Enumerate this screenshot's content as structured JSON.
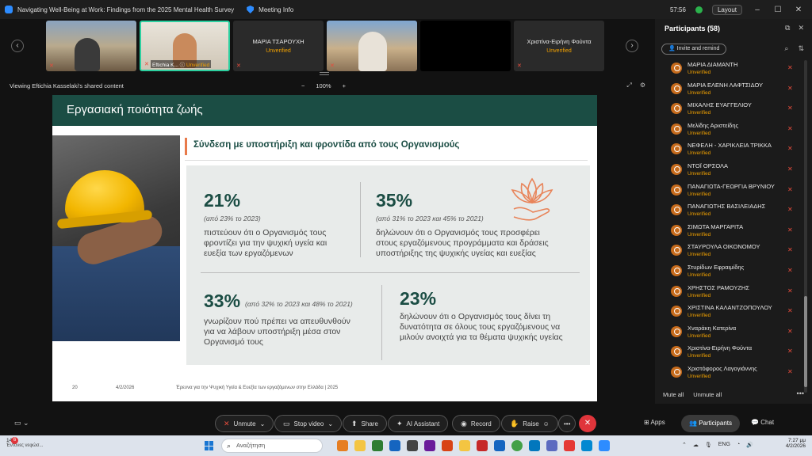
{
  "titlebar": {
    "title": "Navigating Well-Being at Work: Findings from the 2025 Mental Health Survey",
    "meeting_info": "Meeting Info",
    "time": "57:56",
    "layout": "Layout"
  },
  "strip": {
    "tiles": [
      {
        "name": "",
        "status": "",
        "caption_name": "",
        "caption_status": ""
      },
      {
        "name": "",
        "status": "",
        "caption_name": "Eftichia K...",
        "caption_status": "Unverified"
      },
      {
        "name": "ΜΑΡΙΑ ΤΣΑΡΟΥΧΗ",
        "status": "Unverified"
      },
      {
        "name": "",
        "status": ""
      },
      {
        "name": "",
        "status": ""
      },
      {
        "name": "Χριστίνα-Ειρήνη Φούντα",
        "status": "Unverified"
      }
    ]
  },
  "sharebar": {
    "label": "Viewing Eftichia Kasselaki's shared content",
    "zoom": "100%",
    "minus": "−",
    "plus": "+"
  },
  "slide": {
    "header": "Εργασιακή ποιότητα ζωής",
    "subtitle": "Σύνδεση με υποστήριξη και φροντίδα από τους Οργανισμούς",
    "stats": [
      {
        "value": "21%",
        "note": "(από 23% το 2023)",
        "text": [
          "πιστεύουν ότι ο Οργανισμός τους",
          "φροντίζει για την ψυχική υγεία και",
          "ευεξία των εργαζόμενων"
        ]
      },
      {
        "value": "35%",
        "note": "(από 31% το 2023 και 45% το 2021)",
        "text": [
          "δηλώνουν ότι ο Οργανισμός τους προσφέρει",
          "στους εργαζόμενους προγράμματα και δράσεις",
          "υποστήριξης της ψυχικής υγείας και ευεξίας"
        ]
      },
      {
        "value": "33%",
        "note": "(από 32% το 2023 και 48% το 2021)",
        "text": [
          "γνωρίζουν πού πρέπει να απευθυνθούν",
          "για να λάβουν υποστήριξη μέσα στον",
          "Οργανισμό τους"
        ]
      },
      {
        "value": "23%",
        "note": "",
        "text": [
          "δηλώνουν ότι ο Οργανισμός τους δίνει τη",
          "δυνατότητα σε όλους τους εργαζόμενους να",
          "μιλούν ανοιχτά για τα θέματα ψυχικής υγείας"
        ]
      }
    ],
    "footer": {
      "page": "20",
      "date": "4/2/2026",
      "source": "Έρευνα για την Ψυχική Υγεία & Ευεξία των εργαζόμενων στην Ελλάδα | 2025"
    }
  },
  "participants": {
    "title": "Participants (58)",
    "invite": "Invite and remind",
    "list": [
      {
        "name": "ΜΑΡΙΑ ΔΙΑΜΑΝΤΗ",
        "status": "Unverified"
      },
      {
        "name": "ΜΑΡΙΑ ΕΛΕΝΗ ΛΑΦΤΣΙΔΟΥ",
        "status": "Unverified"
      },
      {
        "name": "ΜΙΧΑΛΗΣ ΕΥΑΓΓΕΛΙΟΥ",
        "status": "Unverified"
      },
      {
        "name": "Μελίδης Αριστείδης",
        "status": "Unverified"
      },
      {
        "name": "ΝΕΦΕΛΗ - ΧΑΡΙΚΛΕΙΑ ΤΡΙΚΚΑ",
        "status": "Unverified"
      },
      {
        "name": "ΝΤΟΪ ΟΡΣΟΛΑ",
        "status": "Unverified"
      },
      {
        "name": "ΠΑΝΑΓΙΩΤΑ-ΓΕΩΡΓΙΑ ΒΡΥΝΙΟΥ",
        "status": "Unverified"
      },
      {
        "name": "ΠΑΝΑΓΙΩΤΗΣ ΒΑΣΙΛΕΙΑΔΗΣ",
        "status": "Unverified"
      },
      {
        "name": "ΣΙΜΩΤΑ ΜΑΡΓΑΡΙΤΑ",
        "status": "Unverified"
      },
      {
        "name": "ΣΤΑΥΡΟΥΛΑ ΟΙΚΟΝΟΜΟΥ",
        "status": "Unverified"
      },
      {
        "name": "Στυρίδων Εφραιμίδης",
        "status": "Unverified"
      },
      {
        "name": "ΧΡΗΣΤΟΣ ΡΑΜΟΥΖΗΣ",
        "status": "Unverified"
      },
      {
        "name": "ΧΡΙΣΤΙΝΑ ΚΑΛΑΝΤΖΟΠΟΥΛΟΥ",
        "status": "Unverified"
      },
      {
        "name": "Χναράκη Κατερίνα",
        "status": "Unverified"
      },
      {
        "name": "Χριστίνα-Ειρήνη Φούντα",
        "status": "Unverified"
      },
      {
        "name": "Χριστόφορος Λαγογιάννης",
        "status": "Unverified"
      }
    ],
    "mute_all": "Mute all",
    "unmute_all": "Unmute all"
  },
  "toolbar": {
    "unmute": "Unmute",
    "stop_video": "Stop video",
    "share": "Share",
    "ai_assistant": "AI Assistant",
    "record": "Record",
    "raise": "Raise",
    "apps": "Apps",
    "participants": "Participants",
    "chat": "Chat"
  },
  "taskbar": {
    "temp": "14°C",
    "weather_text": "Έντονες νεφώσ...",
    "search_placeholder": "Αναζήτηση",
    "lang": "ENG",
    "clock_time": "7:27 μμ",
    "clock_date": "4/2/2026",
    "badge": "6"
  },
  "colors": {
    "accent_green": "#1b4d44",
    "unverified": "#f0a000",
    "leave_red": "#e0353b",
    "zoom_blue": "#2d8cff"
  }
}
